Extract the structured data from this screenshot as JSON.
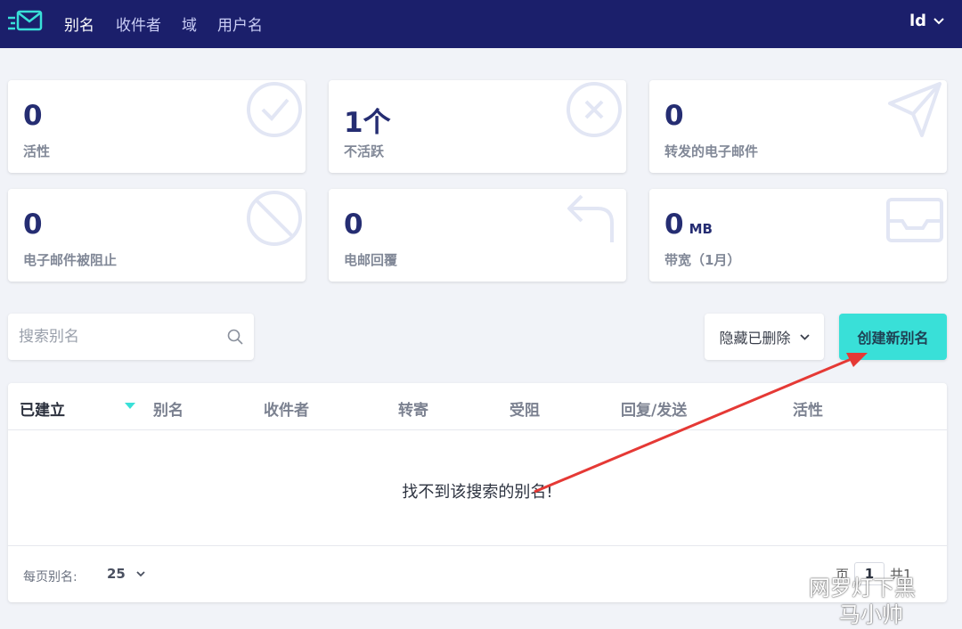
{
  "nav": {
    "items": [
      {
        "label": "别名"
      },
      {
        "label": "收件者"
      },
      {
        "label": "域"
      },
      {
        "label": "用户名"
      }
    ],
    "user": "ld"
  },
  "stats": [
    {
      "value": "0",
      "unit": "",
      "label": "活性",
      "icon": "check-circle-icon"
    },
    {
      "value": "1个",
      "unit": "",
      "label": "不活跃",
      "icon": "x-circle-icon"
    },
    {
      "value": "0",
      "unit": "",
      "label": "转发的电子邮件",
      "icon": "send-icon"
    },
    {
      "value": "0",
      "unit": "",
      "label": "电子邮件被阻止",
      "icon": "ban-icon"
    },
    {
      "value": "0",
      "unit": "",
      "label": "电邮回覆",
      "icon": "reply-icon"
    },
    {
      "value": "0",
      "unit": "MB",
      "label": "带宽（1月）",
      "icon": "inbox-icon"
    }
  ],
  "search": {
    "placeholder": "搜索别名"
  },
  "filter": {
    "selected": "隐藏已删除"
  },
  "create_button": "创建新别名",
  "table": {
    "columns": [
      "已建立",
      "别名",
      "收件者",
      "转寄",
      "受阻",
      "回复/发送",
      "活性"
    ],
    "empty_message": "找不到该搜索的别名!"
  },
  "footer": {
    "per_page_label": "每页别名:",
    "per_page_value": "25",
    "page_prefix": "页",
    "page_current": "1",
    "page_total_text": "共1"
  },
  "watermark": {
    "line1": "网罗灯下黑",
    "line2": "马小帅"
  },
  "colors": {
    "topbar": "#1b1f6b",
    "accent": "#39e0d8",
    "stat_value": "#252d72",
    "annotation_arrow": "#e53935"
  }
}
